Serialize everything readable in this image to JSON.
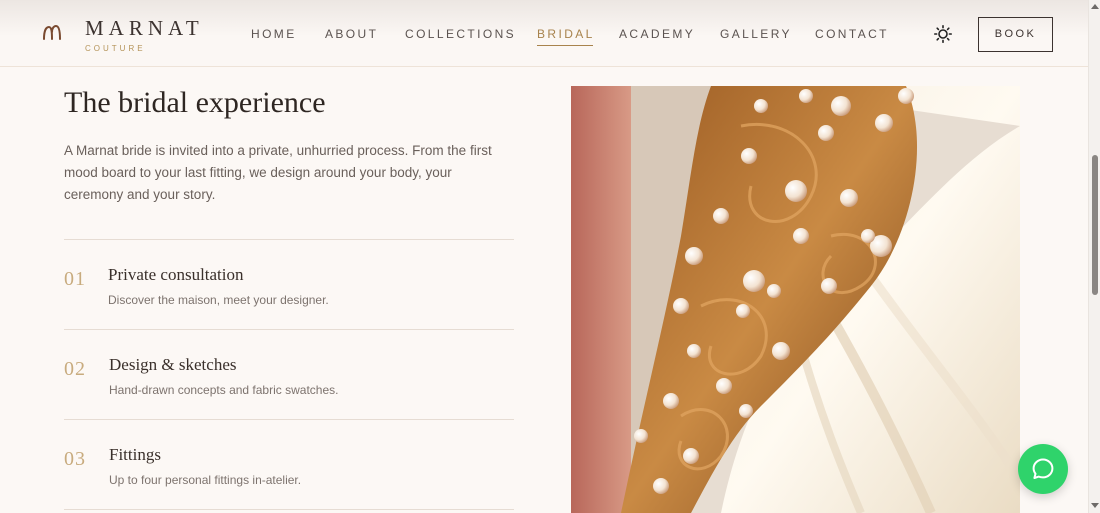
{
  "brand": {
    "name": "MARNAT",
    "tagline": "COUTURE",
    "logo_icon": "monogram-icon",
    "accent_color": "#b5945a"
  },
  "nav": {
    "items": [
      {
        "label": "HOME",
        "active": false
      },
      {
        "label": "ABOUT",
        "active": false
      },
      {
        "label": "COLLECTIONS",
        "active": false
      },
      {
        "label": "BRIDAL",
        "active": true
      },
      {
        "label": "ACADEMY",
        "active": false
      },
      {
        "label": "GALLERY",
        "active": false
      },
      {
        "label": "CONTACT",
        "active": false
      }
    ],
    "theme_icon": "sun-icon",
    "book_label": "BOOK"
  },
  "main": {
    "title": "The bridal experience",
    "intro": "A Marnat bride is invited into a private, unhurried process. From the first mood board to your last fitting, we design around your body, your ceremony and your story.",
    "steps": [
      {
        "number": "01",
        "title": "Private consultation",
        "description": "Discover the maison, meet your designer."
      },
      {
        "number": "02",
        "title": "Design & sketches",
        "description": "Hand-drawn concepts and fabric swatches."
      },
      {
        "number": "03",
        "title": "Fittings",
        "description": "Up to four personal fittings in-atelier."
      }
    ]
  },
  "chat": {
    "icon": "chat-bubble-icon",
    "color": "#2fd36b"
  }
}
